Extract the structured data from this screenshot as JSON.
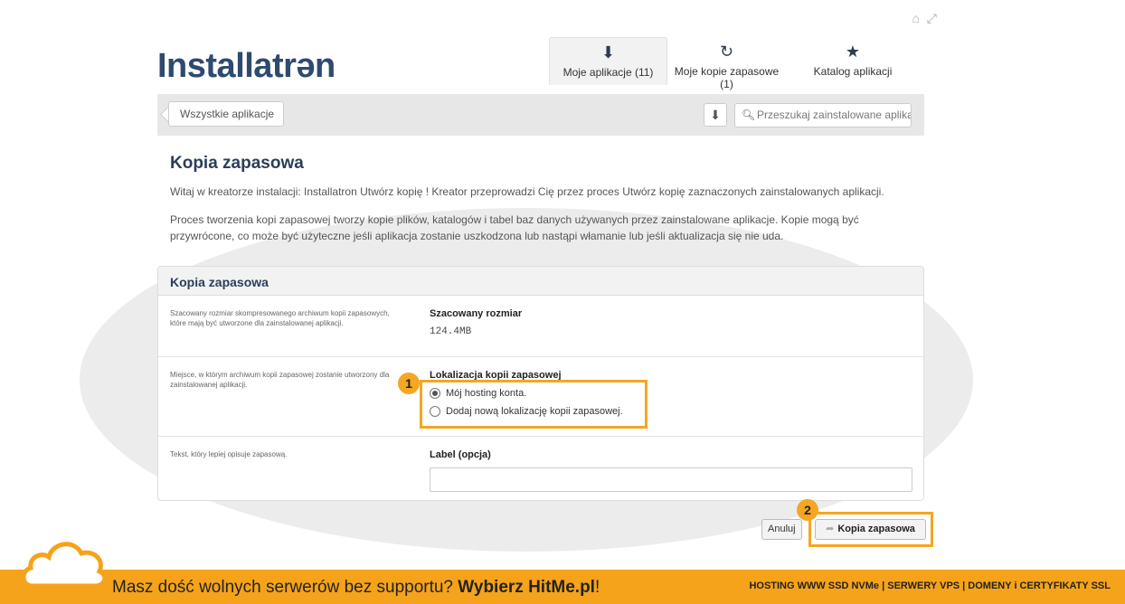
{
  "logo": "Installatrən",
  "nav": {
    "tabs": [
      {
        "label": "Moje aplikacje (11)",
        "icon": "download-circle-icon",
        "glyph": "⬇"
      },
      {
        "label": "Moje kopie zapasowe (1)",
        "icon": "history-icon",
        "glyph": "↻"
      },
      {
        "label": "Katalog aplikacji",
        "icon": "star-icon",
        "glyph": "★"
      }
    ]
  },
  "toolbar": {
    "breadcrumb": "Wszystkie aplikacje",
    "search_placeholder": "Przeszukaj zainstalowane aplikacje"
  },
  "page": {
    "title": "Kopia zapasowa",
    "intro1": "Witaj w kreatorze instalacji: Installatron Utwórz kopię ! Kreator przeprowadzi Cię przez proces Utwórz kopię zaznaczonych zainstalowanych aplikacji.",
    "intro2": "Proces tworzenia kopi zapasowej tworzy kopie plików, katalogów i tabel baz danych używanych przez zainstalowane aplikacje. Kopie mogą być przywrócone, co może być użyteczne jeśli aplikacja zostanie uszkodzona lub nastąpi włamanie lub jeśli aktualizacja się nie uda."
  },
  "panel": {
    "title": "Kopia zapasowa",
    "size": {
      "desc": "Szacowany rozmiar skompresowanego archiwum kopii zapasowych, które mają być utworzone dla zainstalowanej aplikacji.",
      "label": "Szacowany rozmiar",
      "value": "124.4MB"
    },
    "location": {
      "desc": "Miejsce, w którym archiwum kopii zapasowej zostanie utworzony dla zainstalowanej aplikacji.",
      "label": "Lokalizacja kopii zapasowej",
      "option1": "Mój hosting konta.",
      "option2": "Dodaj nową lokalizację kopii zapasowej.",
      "selected": "option1"
    },
    "label_field": {
      "desc": "Tekst, który lepiej opisuje zapasową.",
      "label": "Label (opcja)",
      "value": ""
    }
  },
  "buttons": {
    "cancel": "Anuluj",
    "backup": "Kopia zapasowa"
  },
  "annotations": {
    "badge1": "1",
    "badge2": "2",
    "color": "#f5a623"
  },
  "banner": {
    "text_prefix": "Masz dość wolnych serwerów bez supportu? ",
    "text_bold": "Wybierz HitMe.pl",
    "text_suffix": "!",
    "right": "HOSTING WWW SSD NVMe | SERWERY VPS | DOMENY i CERTYFIKATY SSL",
    "color": "#f5a31a"
  }
}
